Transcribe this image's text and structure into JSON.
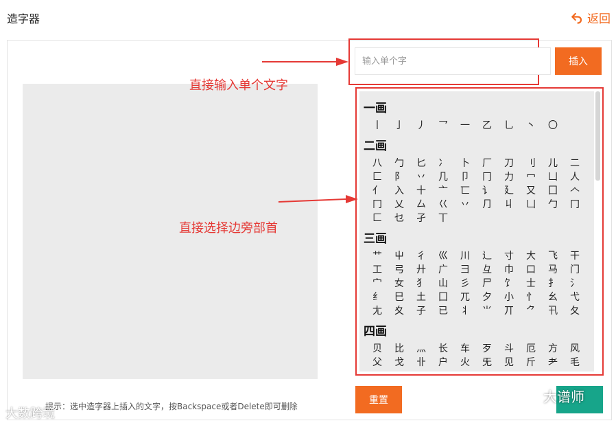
{
  "header": {
    "title": "造字器",
    "back_label": "返回"
  },
  "search": {
    "placeholder": "输入单个字",
    "insert_label": "插入"
  },
  "groups": [
    {
      "heading": "一画",
      "chars": [
        "丨",
        "亅",
        "丿",
        "乛",
        "一",
        "乙",
        "乚",
        "丶",
        "〇"
      ]
    },
    {
      "heading": "二画",
      "chars": [
        "八",
        "勹",
        "匕",
        "冫",
        "卜",
        "厂",
        "刀",
        "刂",
        "儿",
        "二",
        "匚",
        "阝",
        "丷",
        "几",
        "卩",
        "冂",
        "力",
        "冖",
        "凵",
        "人",
        "亻",
        "入",
        "十",
        "亠",
        "匸",
        "讠",
        "廴",
        "又",
        "囗",
        "𠆢",
        "冂",
        "乂",
        "厶",
        "巜",
        "丷",
        "⺆",
        "丩",
        "凵",
        "勹",
        "冂",
        "匚",
        "乜",
        "孑",
        "丅"
      ]
    },
    {
      "heading": "三画",
      "chars": [
        "艹",
        "屮",
        "彳",
        "巛",
        "川",
        "辶",
        "寸",
        "大",
        "飞",
        "干",
        "工",
        "弓",
        "廾",
        "广",
        "彐",
        "彑",
        "巾",
        "口",
        "马",
        "门",
        "宀",
        "女",
        "犭",
        "山",
        "彡",
        "尸",
        "饣",
        "士",
        "扌",
        "氵",
        "纟",
        "巳",
        "土",
        "囗",
        "兀",
        "夕",
        "小",
        "忄",
        "幺",
        "弋",
        "尢",
        "夊",
        "子",
        "已",
        "丬",
        "⺌",
        "丌",
        "⺈",
        "卂",
        "夂"
      ]
    },
    {
      "heading": "四画",
      "chars": [
        "贝",
        "比",
        "灬",
        "长",
        "车",
        "歹",
        "斗",
        "厄",
        "方",
        "风",
        "父",
        "戈",
        "卝",
        "户",
        "火",
        "旡",
        "见",
        "斤",
        "耂",
        "毛"
      ]
    }
  ],
  "reset_label": "重置",
  "hint": "提示：选中造字器上插入的文字，按Backspace或者Delete即可删除",
  "annotations": {
    "input_note": "直接输入单个文字",
    "radical_note": "直接选择边旁部首"
  },
  "watermarks": {
    "right": "大谱师",
    "left": "大数跨境"
  },
  "colors": {
    "accent": "#f26b21",
    "confirm": "#17a58a",
    "annotation": "#e53935",
    "canvas": "#ebebeb"
  }
}
